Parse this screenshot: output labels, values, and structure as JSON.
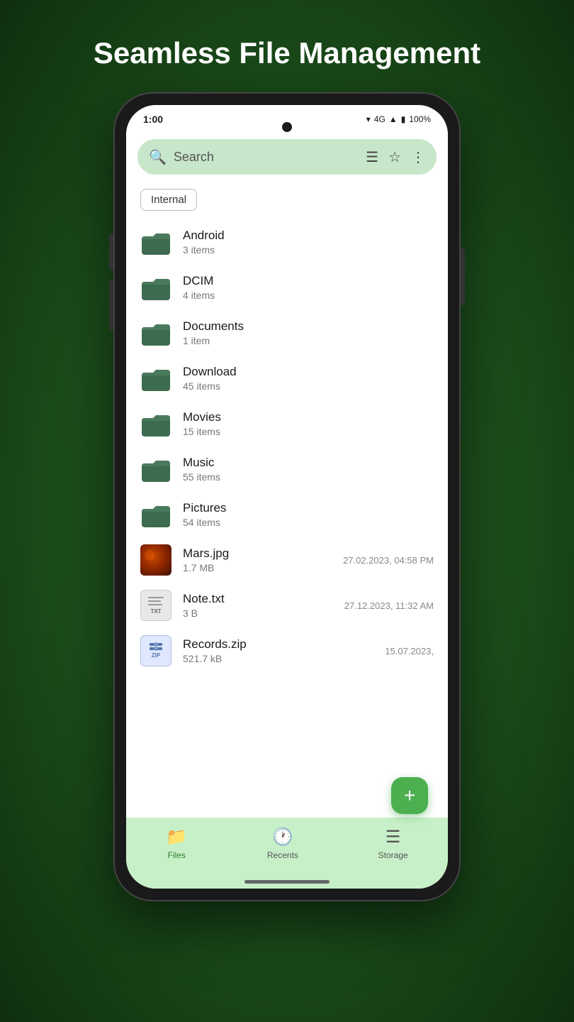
{
  "headline": "Seamless File Management",
  "status": {
    "time": "1:00",
    "signal": "4G",
    "battery": "100%"
  },
  "search": {
    "placeholder": "Search"
  },
  "storage_label": "Internal",
  "folders": [
    {
      "name": "Android",
      "sub": "3 items"
    },
    {
      "name": "DCIM",
      "sub": "4 items"
    },
    {
      "name": "Documents",
      "sub": "1 item"
    },
    {
      "name": "Download",
      "sub": "45 items"
    },
    {
      "name": "Movies",
      "sub": "15 items"
    },
    {
      "name": "Music",
      "sub": "55 items"
    },
    {
      "name": "Pictures",
      "sub": "54 items"
    }
  ],
  "files": [
    {
      "type": "image",
      "name": "Mars.jpg",
      "sub": "1.7 MB",
      "date": "27.02.2023, 04:58 PM"
    },
    {
      "type": "txt",
      "name": "Note.txt",
      "sub": "3 B",
      "date": "27.12.2023, 11:32 AM"
    },
    {
      "type": "zip",
      "name": "Records.zip",
      "sub": "521.7 kB",
      "date": "15.07.2023,"
    }
  ],
  "nav": {
    "items": [
      {
        "id": "files",
        "label": "Files",
        "active": true
      },
      {
        "id": "recents",
        "label": "Recents",
        "active": false
      },
      {
        "id": "storage",
        "label": "Storage",
        "active": false
      }
    ]
  },
  "fab_label": "+"
}
